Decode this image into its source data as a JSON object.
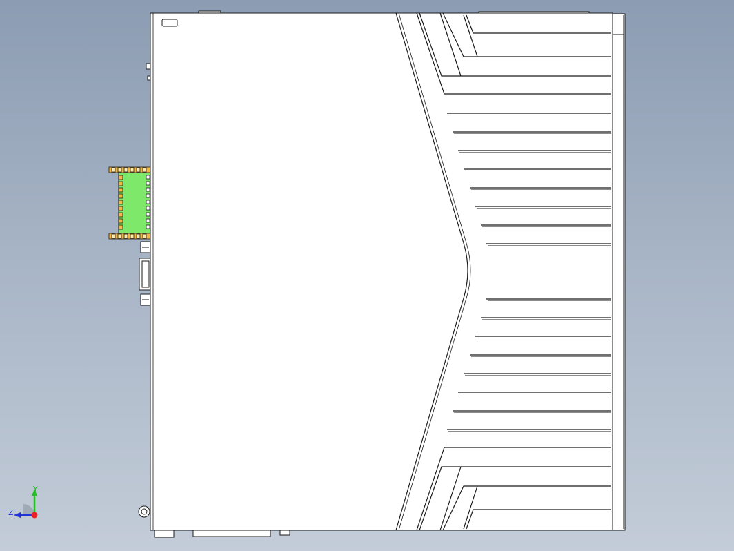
{
  "viewport": {
    "background_top": "#8c9cb2",
    "background_bottom": "#c3ccd8"
  },
  "model": {
    "body_fill": "#ffffff",
    "edge_color": "#1a1a1a",
    "connector_fill": "#7ee86a",
    "connector_pin_fill": "#f0b84a"
  },
  "triad": {
    "y_label": "Y",
    "z_label": "Z",
    "y_color": "#22c022",
    "z_color": "#2233dd",
    "origin_color": "#ee2222"
  }
}
